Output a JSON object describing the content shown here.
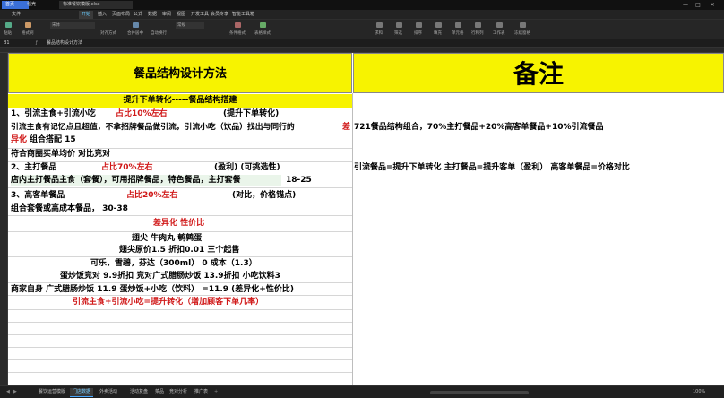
{
  "titlebar": {
    "tabs": [
      "首页",
      "稻壳",
      "标准餐饮模版.xlsx"
    ],
    "controls": [
      "—",
      "□",
      "✕"
    ]
  },
  "menubar": {
    "items": [
      "文件",
      "开始",
      "插入",
      "页面布局",
      "公式",
      "数据",
      "审阅",
      "视图",
      "开发工具",
      "会员专享",
      "智能工具箱"
    ],
    "active_index": 1
  },
  "ribbon": {
    "groups": [
      "粘贴",
      "格式刷",
      "宋体",
      "对齐方式",
      "合并居中",
      "自动换行",
      "常规",
      "条件格式",
      "表格样式",
      "求和",
      "筛选",
      "排序",
      "填充",
      "单元格",
      "行和列",
      "工作表",
      "冻结窗格"
    ]
  },
  "formulabar": {
    "cell_ref": "B1",
    "content": "餐品结构设计方法"
  },
  "sheet": {
    "left_title": "餐品结构设计方法",
    "right_title": "备注",
    "rows": {
      "r1": "提升下单转化-----餐品结构搭建",
      "r2a": "1、引流主食+引流小吃",
      "r2b": "占比10%左右",
      "r2c": "(提升下单转化)",
      "r3a": "引流主食有记忆点且超值，不拿招牌餐品做引流，引流小吃（饮品）找出与同行的",
      "r3b": "差",
      "r4a": "异化",
      "r4b": "组合搭配     15",
      "r5": "符合商圈买单均价  对比竞对",
      "r6a": "2、主打餐品",
      "r6b": "占比70%左右",
      "r6c": "(盈利)   (可挑选性)",
      "r7a": "店内主打餐品主食（套餐），可用招牌餐品，特色餐品，主打套餐",
      "r7b": "18-25",
      "r8a": "3、高客单餐品",
      "r8b": "占比20%左右",
      "r8c": "(对比，价格锚点)",
      "r9": "组合套餐或高成本餐品，      30-38",
      "r10": "差异化 性价比",
      "r11": "翅尖 牛肉丸  鹌鹑蛋",
      "r12": "翅尖原价1.5 折扣0.01 三个起售",
      "r13": "可乐，雪碧，芬达（300ml） 0  成本（1.3）",
      "r14": "蛋炒饭竞对 9.9折扣   竞对广式腊肠炒饭 13.9折扣 小吃饮料3",
      "r15": "商家自身   广式腊肠炒饭  11.9    蛋炒饭+小吃（饮料） =11.9    (差异化+性价比)",
      "r16": "引流主食+引流小吃=提升转化（增加顾客下单几率）"
    },
    "notes": {
      "n1": "721餐品结构组合，70%主打餐品+20%高客单餐品+10%引流餐品",
      "n2": "引流餐品=提升下单转化      主打餐品=提升客单（盈利）    高客单餐品=价格对比"
    }
  },
  "sheetbar": {
    "tabs": [
      "餐饮运营模版",
      "门店数据",
      "外卖活动",
      "活动复盘",
      "菜品",
      "竞对分析",
      "推广表"
    ],
    "active_index": 1,
    "zoom": "100%"
  },
  "colors": {
    "yellow": "#f7f300",
    "red_text": "#d01818",
    "accent": "#4aa8ff"
  }
}
